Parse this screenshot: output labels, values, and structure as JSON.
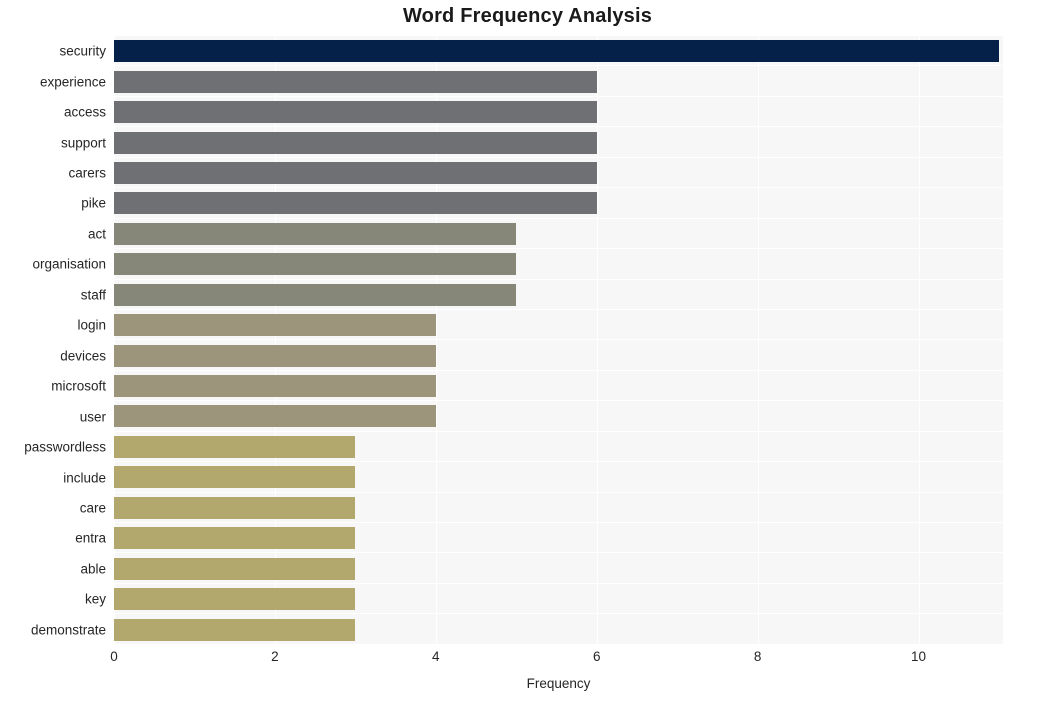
{
  "chart_data": {
    "type": "bar",
    "orientation": "horizontal",
    "title": "Word Frequency Analysis",
    "xlabel": "Frequency",
    "ylabel": "",
    "categories": [
      "security",
      "experience",
      "access",
      "support",
      "carers",
      "pike",
      "act",
      "organisation",
      "staff",
      "login",
      "devices",
      "microsoft",
      "user",
      "passwordless",
      "include",
      "care",
      "entra",
      "able",
      "key",
      "demonstrate"
    ],
    "values": [
      11,
      6,
      6,
      6,
      6,
      6,
      5,
      5,
      5,
      4,
      4,
      4,
      4,
      3,
      3,
      3,
      3,
      3,
      3,
      3
    ],
    "bar_colors": [
      "#052049",
      "#6e7073",
      "#6e7073",
      "#6e7073",
      "#6e7073",
      "#6e7073",
      "#878779",
      "#878779",
      "#878779",
      "#9d957b",
      "#9d957b",
      "#9d957b",
      "#9d957b",
      "#b2a76c",
      "#b2a76c",
      "#b2a76c",
      "#b2a76c",
      "#b2a76c",
      "#b2a76c",
      "#b2a76c"
    ],
    "xlim": [
      0,
      11.05
    ],
    "xticks": [
      0,
      2,
      4,
      6,
      8,
      10
    ],
    "xtick_labels": [
      "0",
      "2",
      "4",
      "6",
      "8",
      "10"
    ],
    "grid": true,
    "grid_color": "#ffffff",
    "plot_background": "#f7f7f7",
    "figure_background": "#ffffff",
    "legend": "none"
  }
}
